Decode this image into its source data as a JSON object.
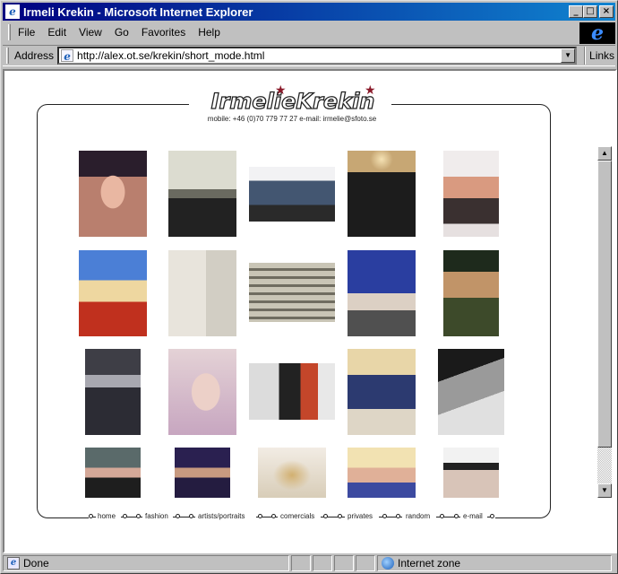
{
  "window": {
    "title": "Irmeli Krekin - Microsoft Internet Explorer",
    "app_icon": "ie-page-icon",
    "buttons": {
      "minimize": "_",
      "maximize": "□",
      "close": "×"
    }
  },
  "menubar": [
    "File",
    "Edit",
    "View",
    "Go",
    "Favorites",
    "Help"
  ],
  "address": {
    "label": "Address",
    "url": "http://alex.ot.se/krekin/short_mode.html",
    "links_label": "Links"
  },
  "page": {
    "logo": "IrmelieKrekin",
    "contact": "mobile: +46 (0)70 779 77 27 e-mail: irmelie@sfoto.se",
    "nav": [
      "home",
      "fashion",
      "artists/portraits",
      "comercials",
      "privates",
      "random",
      "e-mail"
    ],
    "photos": [
      "portrait with beaded headpiece",
      "figure at top of staircase",
      "woman lying on floor",
      "two figures in hats against sunset",
      "woman in bathtub",
      "three women on red wall",
      "woman in hat and red boots",
      "woman before draped curtain",
      "pageant woman with sash",
      "man in cowboy hat",
      "two figures in fur coats",
      "blonde woman close-up",
      "two women with wind-blown hair",
      "women at a game table",
      "black and white nude",
      "man in dark outfit",
      "woman in dark headscarf",
      "woman with curly blonde hair",
      "group of blonde women",
      "woman in black hat"
    ]
  },
  "status": {
    "left": "Done",
    "zone": "Internet zone"
  },
  "colors": {
    "titlebar_start": "#000080",
    "titlebar_end": "#1084d0",
    "star": "#8b1a2a",
    "window_chrome": "#c0c0c0"
  }
}
